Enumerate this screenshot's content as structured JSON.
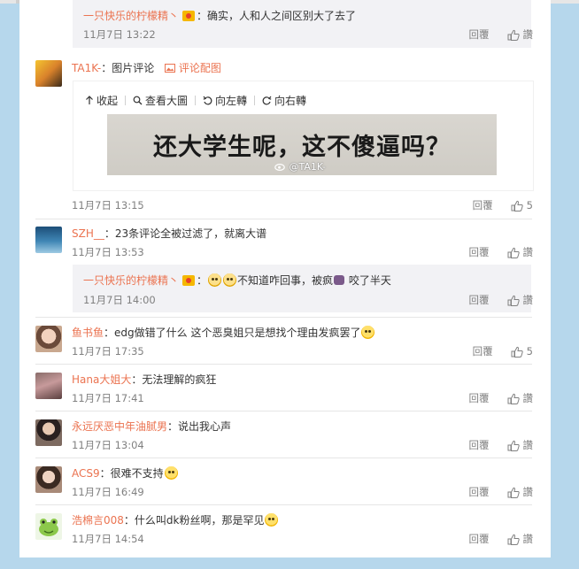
{
  "colors": {
    "accent": "#eb7350",
    "background": "#b6d7ec",
    "panel": "#ffffff",
    "subreply": "#f2f2f5"
  },
  "actions": {
    "reply": "回覆",
    "like": "讚"
  },
  "top_reply": {
    "user": "一只快乐的柠檬精丶",
    "text": "：确实，人和人之间区别大了去了",
    "time": "11月7日 13:22"
  },
  "comments": [
    {
      "user": "TA1K-",
      "text": "：图片评论",
      "extra_link": "评论配图",
      "time": "11月7日 13:15",
      "likes": "5",
      "image": {
        "toolbar": [
          "收起",
          "查看大圖",
          "向左轉",
          "向右轉"
        ],
        "caption": "还大学生呢，这不傻逼吗？",
        "watermark": "@TA1K-"
      }
    },
    {
      "user": "SZH__",
      "text": "：23条评论全被过滤了，就离大谱",
      "time": "11月7日 13:53",
      "likes": "讚",
      "sub_reply": {
        "user": "一只快乐的柠檬精丶",
        "text_after_emoji": "不知道咋回事，被疯",
        "text_tail": " 咬了半天",
        "time": "11月7日 14:00"
      }
    },
    {
      "user": "鱼书鱼",
      "text": "：edg做错了什么 这个恶臭姐只是想找个理由发疯罢了",
      "time": "11月7日 17:35",
      "likes": "5"
    },
    {
      "user": "Hana大姐大",
      "text": "：无法理解的疯狂",
      "time": "11月7日 17:41",
      "likes": "讚"
    },
    {
      "user": "永远厌恶中年油腻男",
      "text": "：说出我心声",
      "time": "11月7日 13:04",
      "likes": "讚"
    },
    {
      "user": "ACS9",
      "text": "：很难不支持",
      "time": "11月7日 16:49",
      "likes": "讚"
    },
    {
      "user": "浩棉言008",
      "text": "：什么叫dk粉丝啊，那是罕见",
      "time": "11月7日 14:54",
      "likes": "讚"
    }
  ]
}
